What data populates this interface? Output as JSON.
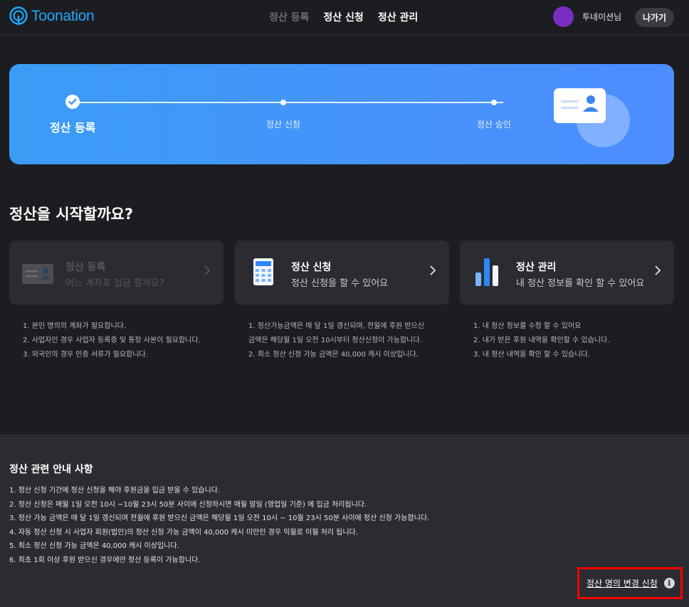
{
  "header": {
    "logo_text": "Toonation",
    "nav": [
      "정산 등록",
      "정산 신청",
      "정산 관리"
    ],
    "user_name": "투네이션님",
    "exit_label": "나가기"
  },
  "banner": {
    "steps": [
      "정산 등록",
      "정산 신청",
      "정산 승인"
    ]
  },
  "section_title": "정산을 시작할까요?",
  "cards": [
    {
      "title": "정산 등록",
      "sub": "어느 계좌로 입금 할까요?",
      "icon": "id-card-icon"
    },
    {
      "title": "정산 신청",
      "sub": "정산 신청을 할 수 있어요",
      "icon": "calculator-icon"
    },
    {
      "title": "정산 관리",
      "sub": "내 정산 정보를 확인 할 수 있어요",
      "icon": "bar-chart-icon"
    }
  ],
  "descriptions": [
    [
      "1. 본인 명의의 계좌가 필요합니다.",
      "2. 사업자인 경우 사업자 등록증 및 통장 사본이 필요합니다.",
      "3. 외국인의 경우 인증 서류가 필요합니다."
    ],
    [
      "1. 정산가능금액은 매 달 1일 갱신되며, 전월에 후원 받으신",
      "금액은 해당월 1일 오전 10시부터 정산신청이 가능합니다.",
      "2. 최소 정산 신청 가능 금액은 40,000 캐시 이상입니다."
    ],
    [
      "1. 내 정산 정보를 수정 할 수 있어요",
      "2. 내가 받은 후원 내역을 확인할 수 있습니다.",
      "3. 내 정산 내역을 확인 할 수 있습니다."
    ]
  ],
  "info": {
    "title": "정산 관련 안내 사항",
    "items": [
      "1. 정산 신청 기간에 정산 신청을 해야 후원금을 입금 받을 수 있습니다.",
      "2. 정산 신청은 매월 1일 오전 10시 ~10월 23시 50분 사이에 신청하시면 매월 말일 (영업일 기준) 에 입금 처리됩니다.",
      "3. 정산 가능 금액은 매 달 1일 갱신되며 전월에 후원 받으신 금액은 해당월 1일 오전 10시 ~ 10월 23시 50분 사이에 정산 신청 가능합니다.",
      "4. 자동 정산 신청 시 사업자 회원(법인)의 정산 신청 가능 금액이 40,000 캐시 미만인 경우 익월로 이월 처리 됩니다.",
      "5. 최소 정산 신청 가능 금액은 40,000 캐시 이상입니다.",
      "6. 최초 1회 이상 후원 받으신 경우에만 정산 등록이 가능합니다."
    ],
    "change_link": "정산 명의 변경 신청",
    "info_glyph": "i"
  },
  "colors": {
    "accent": "#1ea7fd",
    "banner": "#4d8dff",
    "highlight": "#ff0000"
  }
}
